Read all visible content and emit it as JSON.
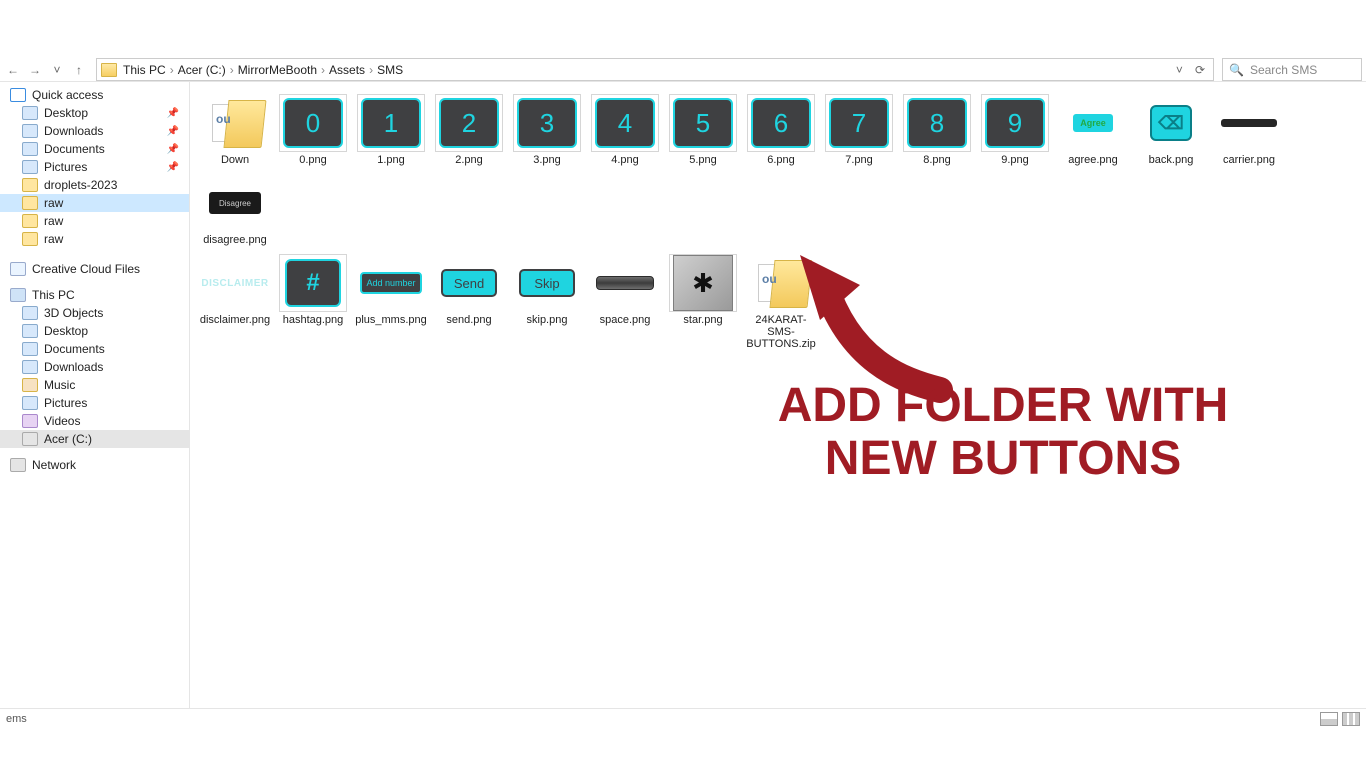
{
  "nav": {
    "back": "←",
    "fwd": "→",
    "recent": "˅",
    "up": "↑",
    "refresh": "⟳",
    "dropdown": "˅"
  },
  "breadcrumb": [
    "This PC",
    "Acer (C:)",
    "MirrorMeBooth",
    "Assets",
    "SMS"
  ],
  "search": {
    "placeholder": "Search SMS"
  },
  "tree": {
    "quick_access": "Quick access",
    "qa_items": [
      {
        "label": "Desktop",
        "pin": true,
        "ico": "blue"
      },
      {
        "label": "Downloads",
        "pin": true,
        "ico": "blue"
      },
      {
        "label": "Documents",
        "pin": true,
        "ico": "blue"
      },
      {
        "label": "Pictures",
        "pin": true,
        "ico": "blue"
      },
      {
        "label": "droplets-2023",
        "pin": false,
        "ico": ""
      },
      {
        "label": "raw",
        "pin": false,
        "ico": "",
        "selected": true
      },
      {
        "label": "raw",
        "pin": false,
        "ico": ""
      },
      {
        "label": "raw",
        "pin": false,
        "ico": ""
      }
    ],
    "ccf": "Creative Cloud Files",
    "this_pc": "This PC",
    "pc_items": [
      {
        "label": "3D Objects",
        "ico": "blue"
      },
      {
        "label": "Desktop",
        "ico": "blue"
      },
      {
        "label": "Documents",
        "ico": "blue"
      },
      {
        "label": "Downloads",
        "ico": "blue"
      },
      {
        "label": "Music",
        "ico": "music"
      },
      {
        "label": "Pictures",
        "ico": "blue"
      },
      {
        "label": "Videos",
        "ico": "vid"
      },
      {
        "label": "Acer (C:)",
        "ico": "drive",
        "gray": true
      }
    ],
    "network": "Network"
  },
  "files_row1": [
    {
      "name": "Down",
      "kind": "folder"
    },
    {
      "name": "0.png",
      "kind": "num",
      "glyph": "0"
    },
    {
      "name": "1.png",
      "kind": "num",
      "glyph": "1"
    },
    {
      "name": "2.png",
      "kind": "num",
      "glyph": "2"
    },
    {
      "name": "3.png",
      "kind": "num",
      "glyph": "3"
    },
    {
      "name": "4.png",
      "kind": "num",
      "glyph": "4"
    },
    {
      "name": "5.png",
      "kind": "num",
      "glyph": "5"
    },
    {
      "name": "6.png",
      "kind": "num",
      "glyph": "6"
    },
    {
      "name": "7.png",
      "kind": "num",
      "glyph": "7"
    },
    {
      "name": "8.png",
      "kind": "num",
      "glyph": "8"
    },
    {
      "name": "9.png",
      "kind": "num",
      "glyph": "9"
    },
    {
      "name": "agree.png",
      "kind": "agree",
      "glyph": "Agree"
    },
    {
      "name": "back.png",
      "kind": "back",
      "glyph": "⌫"
    },
    {
      "name": "carrier.png",
      "kind": "carrier"
    },
    {
      "name": "disagree.png",
      "kind": "disagree",
      "glyph": "Disagree"
    }
  ],
  "files_row2": [
    {
      "name": "disclaimer.png",
      "kind": "disclaimer",
      "glyph": "DISCLAIMER"
    },
    {
      "name": "hashtag.png",
      "kind": "hashtag",
      "glyph": "#"
    },
    {
      "name": "plus_mms.png",
      "kind": "addnum",
      "glyph": "Add number"
    },
    {
      "name": "send.png",
      "kind": "send",
      "glyph": "Send"
    },
    {
      "name": "skip.png",
      "kind": "skip",
      "glyph": "Skip"
    },
    {
      "name": "space.png",
      "kind": "space"
    },
    {
      "name": "star.png",
      "kind": "star",
      "glyph": "✱"
    },
    {
      "name": "24KARAT-SMS-BUTTONS.zip",
      "kind": "folder"
    }
  ],
  "annotation": {
    "line1": "ADD FOLDER WITH",
    "line2": "NEW BUTTONS"
  },
  "status": {
    "items": "ems"
  }
}
